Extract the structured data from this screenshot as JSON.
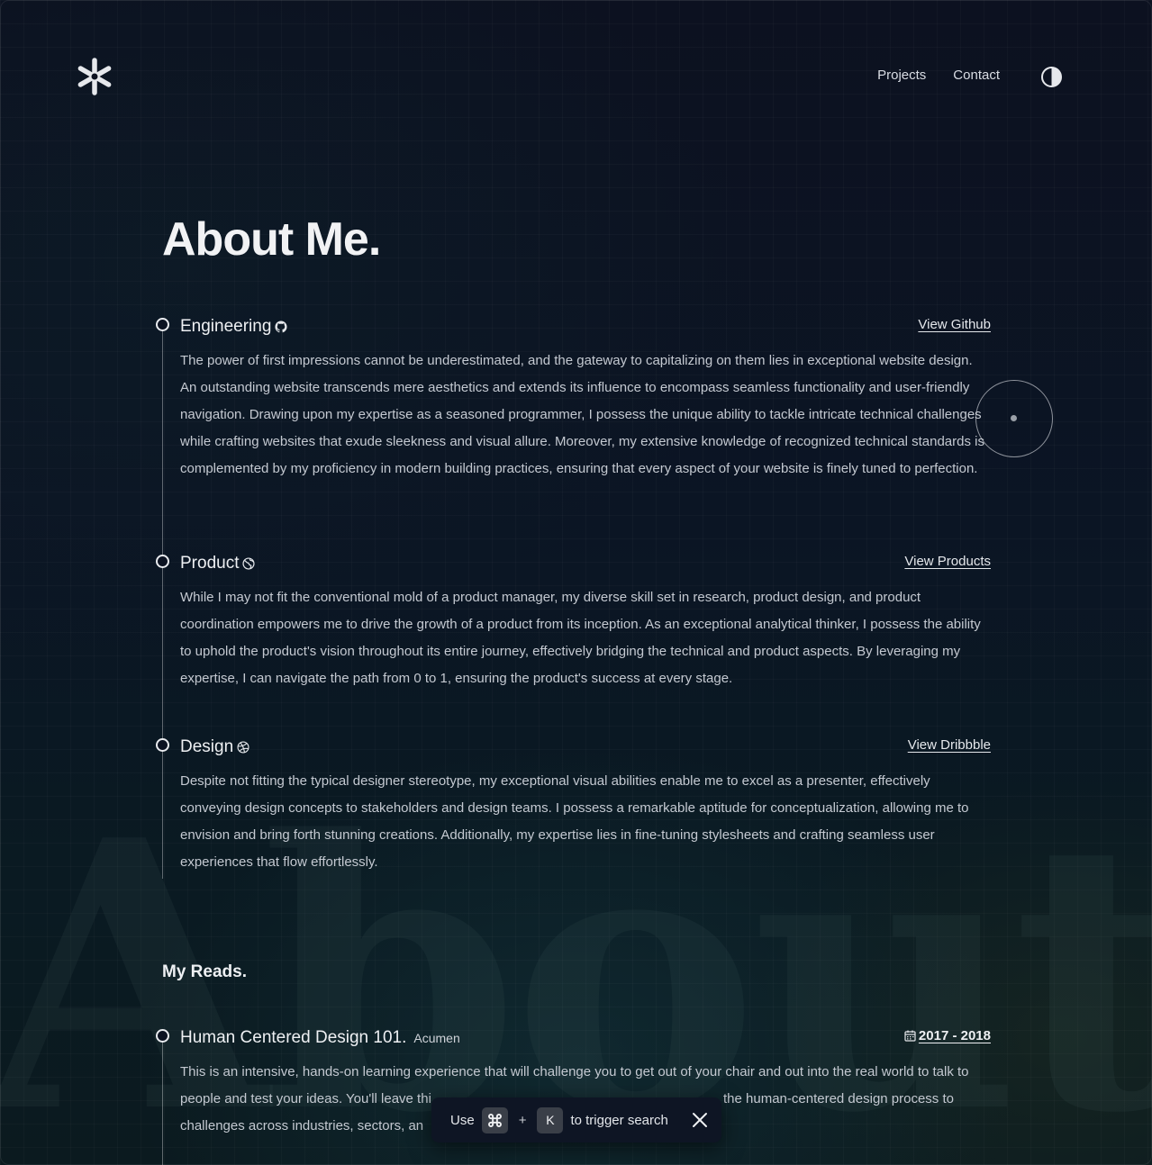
{
  "header": {
    "logo_icon": "asterisk-logo-icon",
    "nav": [
      {
        "label": "Projects"
      },
      {
        "label": "Contact"
      }
    ],
    "theme_toggle_icon": "contrast-icon"
  },
  "watermark": "About M",
  "page_title": "About Me.",
  "sections": [
    {
      "title": "Engineering",
      "icon": "github-icon",
      "link": "View Github",
      "body": "The power of first impressions cannot be underestimated, and the gateway to capitalizing on them lies in exceptional website design. An outstanding website transcends mere aesthetics and extends its influence to encompass seamless functionality and user-friendly navigation. Drawing upon my expertise as a seasoned programmer, I possess the unique ability to tackle intricate technical challenges while crafting websites that exude sleekness and visual allure. Moreover, my extensive knowledge of recognized technical standards is complemented by my proficiency in modern building practices, ensuring that every aspect of your website is finely tuned to perfection."
    },
    {
      "title": "Product",
      "icon": "globe-icon",
      "link": "View Products",
      "body": "While I may not fit the conventional mold of a product manager, my diverse skill set in research, product design, and product coordination empowers me to drive the growth of a product from its inception. As an exceptional analytical thinker, I possess the ability to uphold the product's vision throughout its entire journey, effectively bridging the technical and product aspects. By leveraging my expertise, I can navigate the path from 0 to 1, ensuring the product's success at every stage."
    },
    {
      "title": "Design",
      "icon": "dribbble-icon",
      "link": "View Dribbble",
      "body": "Despite not fitting the typical designer stereotype, my exceptional visual abilities enable me to excel as a presenter, effectively conveying design concepts to stakeholders and design teams. I possess a remarkable aptitude for conceptualization, allowing me to envision and bring forth stunning creations. Additionally, my expertise lies in fine-tuning stylesheets and crafting seamless user experiences that flow effortlessly."
    }
  ],
  "reads": {
    "title": "My Reads.",
    "items": [
      {
        "title": "Human Centered Design 101.",
        "source": "Acumen",
        "date_icon": "calendar-icon",
        "date": "2017 - 2018",
        "body_line1": "This is an intensive, hands-on learning experience that will challenge you to get out of your chair and out into the real world to talk to",
        "body_line2_left": "people and test your ideas. You'll leave thi",
        "body_line2_right": "the human-centered design process to",
        "body_line3": "challenges across industries, sectors, an"
      }
    ]
  },
  "search_toast": {
    "use": "Use",
    "key1_icon": "command-key-icon",
    "plus": "+",
    "key2": "K",
    "trigger": "to trigger search",
    "close_icon": "close-icon"
  }
}
